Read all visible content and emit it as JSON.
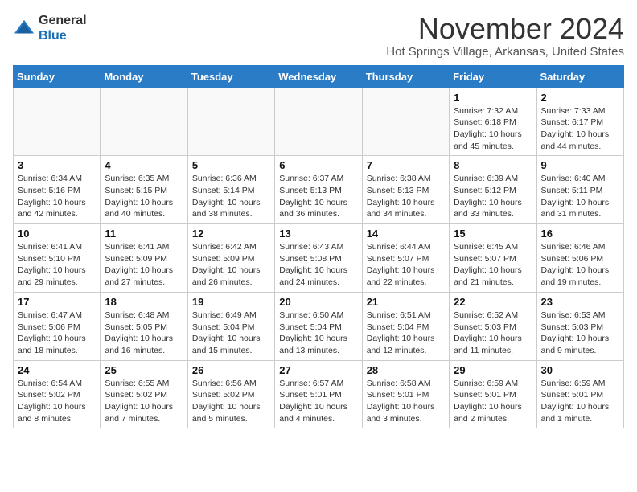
{
  "logo": {
    "general": "General",
    "blue": "Blue"
  },
  "header": {
    "month": "November 2024",
    "location": "Hot Springs Village, Arkansas, United States"
  },
  "weekdays": [
    "Sunday",
    "Monday",
    "Tuesday",
    "Wednesday",
    "Thursday",
    "Friday",
    "Saturday"
  ],
  "weeks": [
    [
      {
        "day": "",
        "empty": true
      },
      {
        "day": "",
        "empty": true
      },
      {
        "day": "",
        "empty": true
      },
      {
        "day": "",
        "empty": true
      },
      {
        "day": "",
        "empty": true
      },
      {
        "day": "1",
        "sunrise": "Sunrise: 7:32 AM",
        "sunset": "Sunset: 6:18 PM",
        "daylight": "Daylight: 10 hours and 45 minutes."
      },
      {
        "day": "2",
        "sunrise": "Sunrise: 7:33 AM",
        "sunset": "Sunset: 6:17 PM",
        "daylight": "Daylight: 10 hours and 44 minutes."
      }
    ],
    [
      {
        "day": "3",
        "sunrise": "Sunrise: 6:34 AM",
        "sunset": "Sunset: 5:16 PM",
        "daylight": "Daylight: 10 hours and 42 minutes."
      },
      {
        "day": "4",
        "sunrise": "Sunrise: 6:35 AM",
        "sunset": "Sunset: 5:15 PM",
        "daylight": "Daylight: 10 hours and 40 minutes."
      },
      {
        "day": "5",
        "sunrise": "Sunrise: 6:36 AM",
        "sunset": "Sunset: 5:14 PM",
        "daylight": "Daylight: 10 hours and 38 minutes."
      },
      {
        "day": "6",
        "sunrise": "Sunrise: 6:37 AM",
        "sunset": "Sunset: 5:13 PM",
        "daylight": "Daylight: 10 hours and 36 minutes."
      },
      {
        "day": "7",
        "sunrise": "Sunrise: 6:38 AM",
        "sunset": "Sunset: 5:13 PM",
        "daylight": "Daylight: 10 hours and 34 minutes."
      },
      {
        "day": "8",
        "sunrise": "Sunrise: 6:39 AM",
        "sunset": "Sunset: 5:12 PM",
        "daylight": "Daylight: 10 hours and 33 minutes."
      },
      {
        "day": "9",
        "sunrise": "Sunrise: 6:40 AM",
        "sunset": "Sunset: 5:11 PM",
        "daylight": "Daylight: 10 hours and 31 minutes."
      }
    ],
    [
      {
        "day": "10",
        "sunrise": "Sunrise: 6:41 AM",
        "sunset": "Sunset: 5:10 PM",
        "daylight": "Daylight: 10 hours and 29 minutes."
      },
      {
        "day": "11",
        "sunrise": "Sunrise: 6:41 AM",
        "sunset": "Sunset: 5:09 PM",
        "daylight": "Daylight: 10 hours and 27 minutes."
      },
      {
        "day": "12",
        "sunrise": "Sunrise: 6:42 AM",
        "sunset": "Sunset: 5:09 PM",
        "daylight": "Daylight: 10 hours and 26 minutes."
      },
      {
        "day": "13",
        "sunrise": "Sunrise: 6:43 AM",
        "sunset": "Sunset: 5:08 PM",
        "daylight": "Daylight: 10 hours and 24 minutes."
      },
      {
        "day": "14",
        "sunrise": "Sunrise: 6:44 AM",
        "sunset": "Sunset: 5:07 PM",
        "daylight": "Daylight: 10 hours and 22 minutes."
      },
      {
        "day": "15",
        "sunrise": "Sunrise: 6:45 AM",
        "sunset": "Sunset: 5:07 PM",
        "daylight": "Daylight: 10 hours and 21 minutes."
      },
      {
        "day": "16",
        "sunrise": "Sunrise: 6:46 AM",
        "sunset": "Sunset: 5:06 PM",
        "daylight": "Daylight: 10 hours and 19 minutes."
      }
    ],
    [
      {
        "day": "17",
        "sunrise": "Sunrise: 6:47 AM",
        "sunset": "Sunset: 5:06 PM",
        "daylight": "Daylight: 10 hours and 18 minutes."
      },
      {
        "day": "18",
        "sunrise": "Sunrise: 6:48 AM",
        "sunset": "Sunset: 5:05 PM",
        "daylight": "Daylight: 10 hours and 16 minutes."
      },
      {
        "day": "19",
        "sunrise": "Sunrise: 6:49 AM",
        "sunset": "Sunset: 5:04 PM",
        "daylight": "Daylight: 10 hours and 15 minutes."
      },
      {
        "day": "20",
        "sunrise": "Sunrise: 6:50 AM",
        "sunset": "Sunset: 5:04 PM",
        "daylight": "Daylight: 10 hours and 13 minutes."
      },
      {
        "day": "21",
        "sunrise": "Sunrise: 6:51 AM",
        "sunset": "Sunset: 5:04 PM",
        "daylight": "Daylight: 10 hours and 12 minutes."
      },
      {
        "day": "22",
        "sunrise": "Sunrise: 6:52 AM",
        "sunset": "Sunset: 5:03 PM",
        "daylight": "Daylight: 10 hours and 11 minutes."
      },
      {
        "day": "23",
        "sunrise": "Sunrise: 6:53 AM",
        "sunset": "Sunset: 5:03 PM",
        "daylight": "Daylight: 10 hours and 9 minutes."
      }
    ],
    [
      {
        "day": "24",
        "sunrise": "Sunrise: 6:54 AM",
        "sunset": "Sunset: 5:02 PM",
        "daylight": "Daylight: 10 hours and 8 minutes."
      },
      {
        "day": "25",
        "sunrise": "Sunrise: 6:55 AM",
        "sunset": "Sunset: 5:02 PM",
        "daylight": "Daylight: 10 hours and 7 minutes."
      },
      {
        "day": "26",
        "sunrise": "Sunrise: 6:56 AM",
        "sunset": "Sunset: 5:02 PM",
        "daylight": "Daylight: 10 hours and 5 minutes."
      },
      {
        "day": "27",
        "sunrise": "Sunrise: 6:57 AM",
        "sunset": "Sunset: 5:01 PM",
        "daylight": "Daylight: 10 hours and 4 minutes."
      },
      {
        "day": "28",
        "sunrise": "Sunrise: 6:58 AM",
        "sunset": "Sunset: 5:01 PM",
        "daylight": "Daylight: 10 hours and 3 minutes."
      },
      {
        "day": "29",
        "sunrise": "Sunrise: 6:59 AM",
        "sunset": "Sunset: 5:01 PM",
        "daylight": "Daylight: 10 hours and 2 minutes."
      },
      {
        "day": "30",
        "sunrise": "Sunrise: 6:59 AM",
        "sunset": "Sunset: 5:01 PM",
        "daylight": "Daylight: 10 hours and 1 minute."
      }
    ]
  ]
}
